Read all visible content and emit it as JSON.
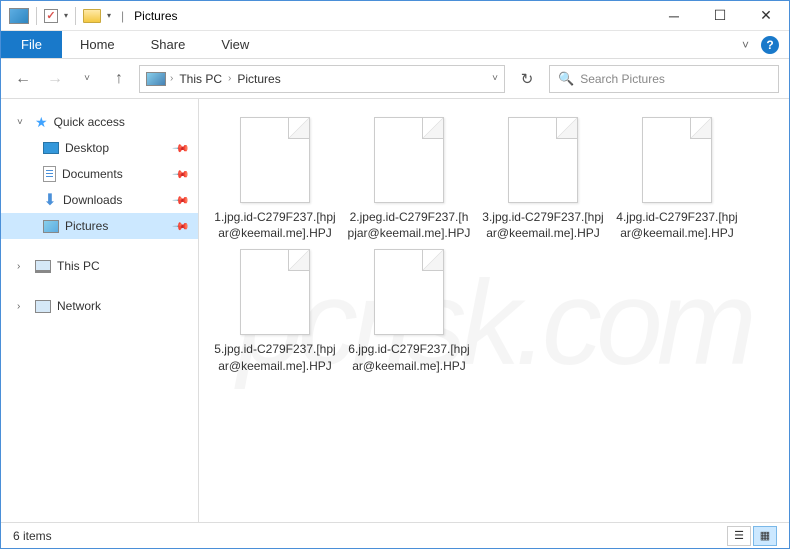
{
  "title": {
    "window": "Pictures"
  },
  "tabs": {
    "file": "File",
    "home": "Home",
    "share": "Share",
    "view": "View"
  },
  "breadcrumb": {
    "root": "This PC",
    "current": "Pictures"
  },
  "search": {
    "placeholder": "Search Pictures"
  },
  "sidebar": {
    "quickaccess": "Quick access",
    "desktop": "Desktop",
    "documents": "Documents",
    "downloads": "Downloads",
    "pictures": "Pictures",
    "thispc": "This PC",
    "network": "Network"
  },
  "files": [
    {
      "name": "1.jpg.id-C279F237.[hpjar@keemail.me].HPJ"
    },
    {
      "name": "2.jpeg.id-C279F237.[hpjar@keemail.me].HPJ"
    },
    {
      "name": "3.jpg.id-C279F237.[hpjar@keemail.me].HPJ"
    },
    {
      "name": "4.jpg.id-C279F237.[hpjar@keemail.me].HPJ"
    },
    {
      "name": "5.jpg.id-C279F237.[hpjar@keemail.me].HPJ"
    },
    {
      "name": "6.jpg.id-C279F237.[hpjar@keemail.me].HPJ"
    }
  ],
  "status": {
    "count": "6 items"
  },
  "watermark": "pcrisk.com"
}
